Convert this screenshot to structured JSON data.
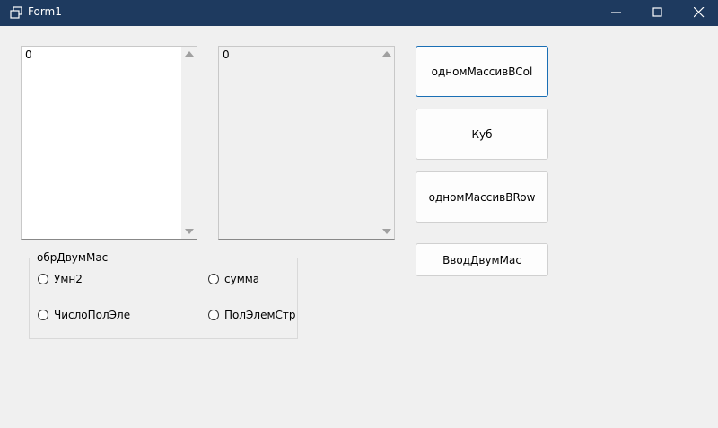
{
  "window": {
    "title": "Form1"
  },
  "lists": {
    "left_item": "0",
    "right_item": "0"
  },
  "buttons": {
    "col": "одномМассивBCol",
    "cube": "Куб",
    "row": "одномМассивBRow",
    "input": "ВводДвумМас"
  },
  "group": {
    "title": "обрДвумМас",
    "options": [
      "Умн2",
      "сумма",
      "ЧислоПолЭле",
      "ПолЭлемСтр"
    ]
  }
}
